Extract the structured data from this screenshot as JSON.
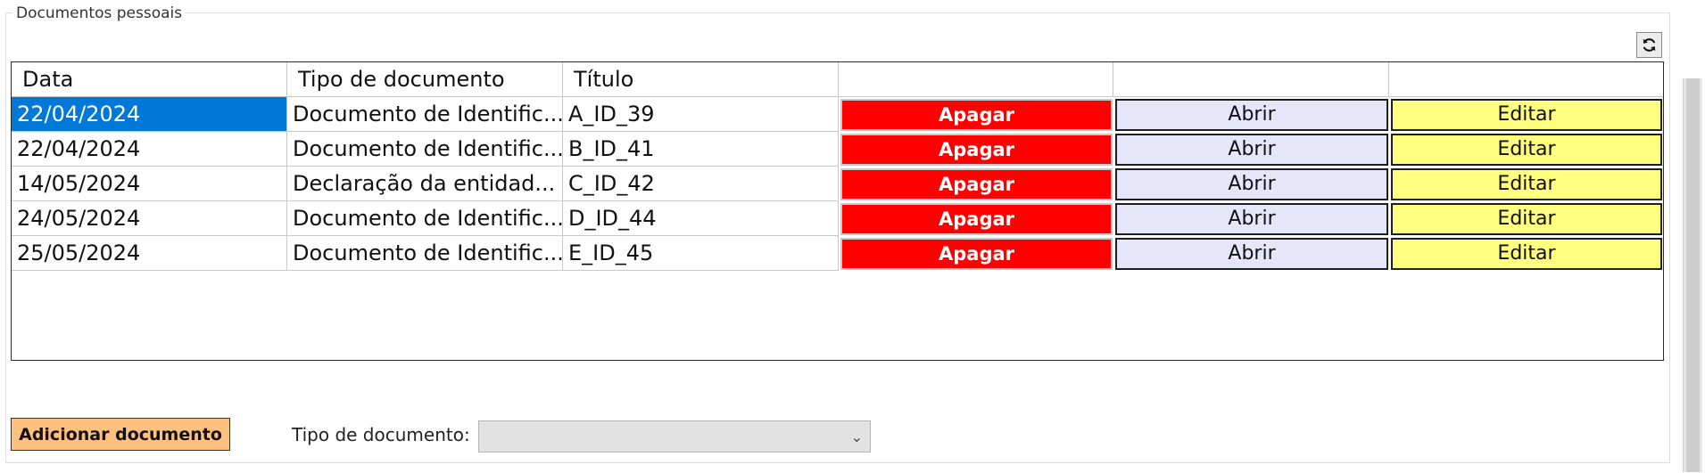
{
  "groupbox": {
    "legend": "Documentos pessoais"
  },
  "table": {
    "headers": [
      "Data",
      "Tipo de documento",
      "Título",
      "",
      "",
      ""
    ],
    "rows": [
      {
        "data": "22/04/2024",
        "tipo": "Documento de Identific...",
        "titulo": "A_ID_39",
        "apagar": "Apagar",
        "abrir": "Abrir",
        "editar": "Editar"
      },
      {
        "data": "22/04/2024",
        "tipo": "Documento de Identific...",
        "titulo": "B_ID_41",
        "apagar": "Apagar",
        "abrir": "Abrir",
        "editar": "Editar"
      },
      {
        "data": "14/05/2024",
        "tipo": "Declaração da entidad...",
        "titulo": "C_ID_42",
        "apagar": "Apagar",
        "abrir": "Abrir",
        "editar": "Editar"
      },
      {
        "data": "24/05/2024",
        "tipo": "Documento de Identific...",
        "titulo": "D_ID_44",
        "apagar": "Apagar",
        "abrir": "Abrir",
        "editar": "Editar"
      },
      {
        "data": "25/05/2024",
        "tipo": "Documento de Identific...",
        "titulo": "E_ID_45",
        "apagar": "Apagar",
        "abrir": "Abrir",
        "editar": "Editar"
      }
    ]
  },
  "footer": {
    "add_button": "Adicionar documento",
    "tipo_label": "Tipo de documento:",
    "tipo_select_value": ""
  },
  "icons": {
    "refresh": "refresh-icon",
    "dropdown": "chevron-down-icon"
  },
  "colors": {
    "selected_cell": "#0078d7",
    "apagar": "#ff0000",
    "abrir": "#e6e6fa",
    "editar": "#ffff80",
    "add_button": "#ffc080"
  }
}
